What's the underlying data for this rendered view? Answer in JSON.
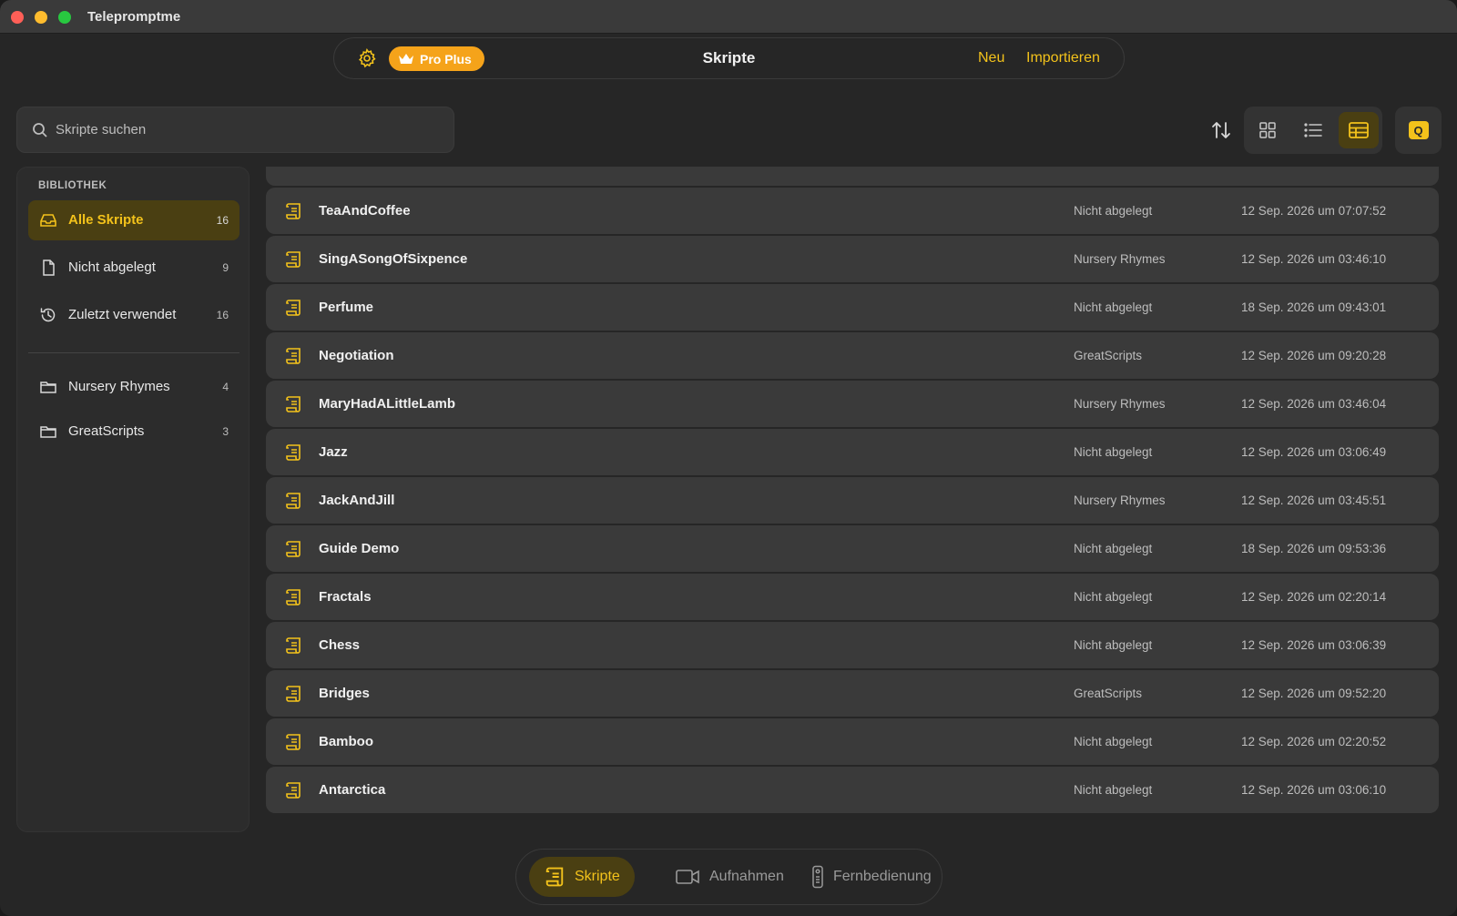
{
  "app": {
    "title": "Telepromptme"
  },
  "toolbar": {
    "badge_label": "Pro Plus",
    "title": "Skripte",
    "new_label": "Neu",
    "import_label": "Importieren"
  },
  "search": {
    "placeholder": "Skripte suchen",
    "value": ""
  },
  "sidebar": {
    "header": "BIBLIOTHEK",
    "items": [
      {
        "label": "Alle Skripte",
        "count": "16",
        "icon": "tray-icon",
        "active": true
      },
      {
        "label": "Nicht abgelegt",
        "count": "9",
        "icon": "document-icon"
      },
      {
        "label": "Zuletzt verwendet",
        "count": "16",
        "icon": "clock-history-icon"
      }
    ],
    "folders": [
      {
        "label": "Nursery Rhymes",
        "count": "4",
        "icon": "folder-icon"
      },
      {
        "label": "GreatScripts",
        "count": "3",
        "icon": "folder-icon"
      }
    ]
  },
  "scripts": [
    {
      "name": "TeaAndCoffee",
      "folder": "Nicht abgelegt",
      "date": "12 Sep. 2026 um 07:07:52"
    },
    {
      "name": "SingASongOfSixpence",
      "folder": "Nursery Rhymes",
      "date": "12 Sep. 2026 um 03:46:10"
    },
    {
      "name": "Perfume",
      "folder": "Nicht abgelegt",
      "date": "18 Sep. 2026 um 09:43:01"
    },
    {
      "name": "Negotiation",
      "folder": "GreatScripts",
      "date": "12 Sep. 2026 um 09:20:28"
    },
    {
      "name": "MaryHadALittleLamb",
      "folder": "Nursery Rhymes",
      "date": "12 Sep. 2026 um 03:46:04"
    },
    {
      "name": "Jazz",
      "folder": "Nicht abgelegt",
      "date": "12 Sep. 2026 um 03:06:49"
    },
    {
      "name": "JackAndJill",
      "folder": "Nursery Rhymes",
      "date": "12 Sep. 2026 um 03:45:51"
    },
    {
      "name": "Guide Demo",
      "folder": "Nicht abgelegt",
      "date": "18 Sep. 2026 um 09:53:36"
    },
    {
      "name": "Fractals",
      "folder": "Nicht abgelegt",
      "date": "12 Sep. 2026 um 02:20:14"
    },
    {
      "name": "Chess",
      "folder": "Nicht abgelegt",
      "date": "12 Sep. 2026 um 03:06:39"
    },
    {
      "name": "Bridges",
      "folder": "GreatScripts",
      "date": "12 Sep. 2026 um 09:52:20"
    },
    {
      "name": "Bamboo",
      "folder": "Nicht abgelegt",
      "date": "12 Sep. 2026 um 02:20:52"
    },
    {
      "name": "Antarctica",
      "folder": "Nicht abgelegt",
      "date": "12 Sep. 2026 um 03:06:10"
    }
  ],
  "tabs": [
    {
      "label": "Skripte",
      "icon": "script-icon",
      "active": true
    },
    {
      "label": "Aufnahmen",
      "icon": "video-camera-icon"
    },
    {
      "label": "Fernbedienung",
      "icon": "remote-icon"
    }
  ],
  "colors": {
    "accent": "#f3c21b",
    "badge": "#f5a31a",
    "active_bg": "#4a3f12"
  }
}
